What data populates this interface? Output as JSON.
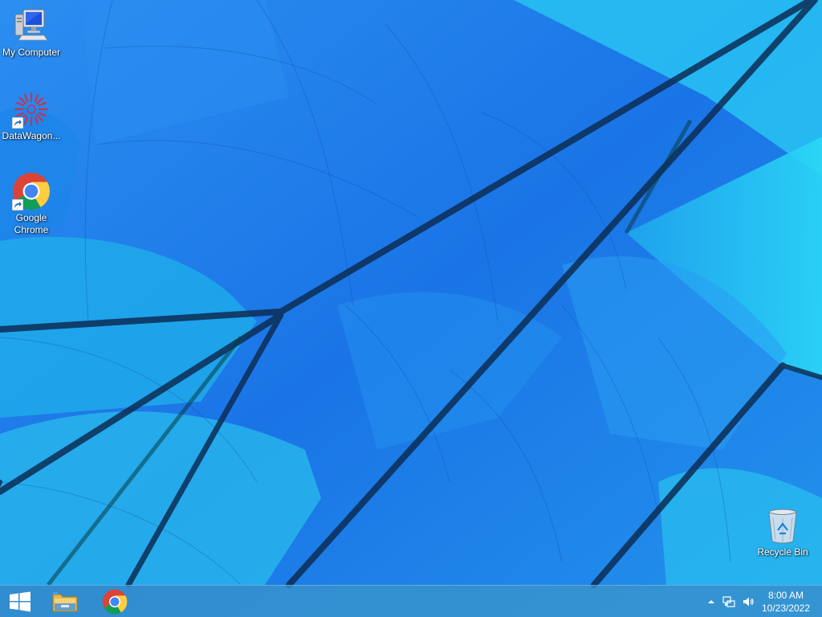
{
  "desktop": {
    "icons": [
      {
        "label": "My Computer",
        "icon": "computer-icon"
      },
      {
        "label": "DataWagon...",
        "icon": "datawagon-icon"
      },
      {
        "label": "Google Chrome",
        "icon": "chrome-icon"
      },
      {
        "label": "Recycle Bin",
        "icon": "recycle-bin-icon"
      }
    ]
  },
  "taskbar": {
    "start_icon": "windows-logo-icon",
    "pinned": [
      {
        "icon": "file-explorer-icon"
      },
      {
        "icon": "chrome-icon"
      }
    ],
    "tray": {
      "overflow_icon": "chevron-up-icon",
      "network_icon": "network-icon",
      "volume_icon": "speaker-icon",
      "time": "8:00 AM",
      "date": "10/23/2022"
    }
  },
  "colors": {
    "wallpaper_base": "#1a7fea",
    "wallpaper_light": "#2bb6ef",
    "wallpaper_cyan": "#28d3f5",
    "wallpaper_lines": "#0b2a50",
    "taskbar": "#3c96c8"
  }
}
